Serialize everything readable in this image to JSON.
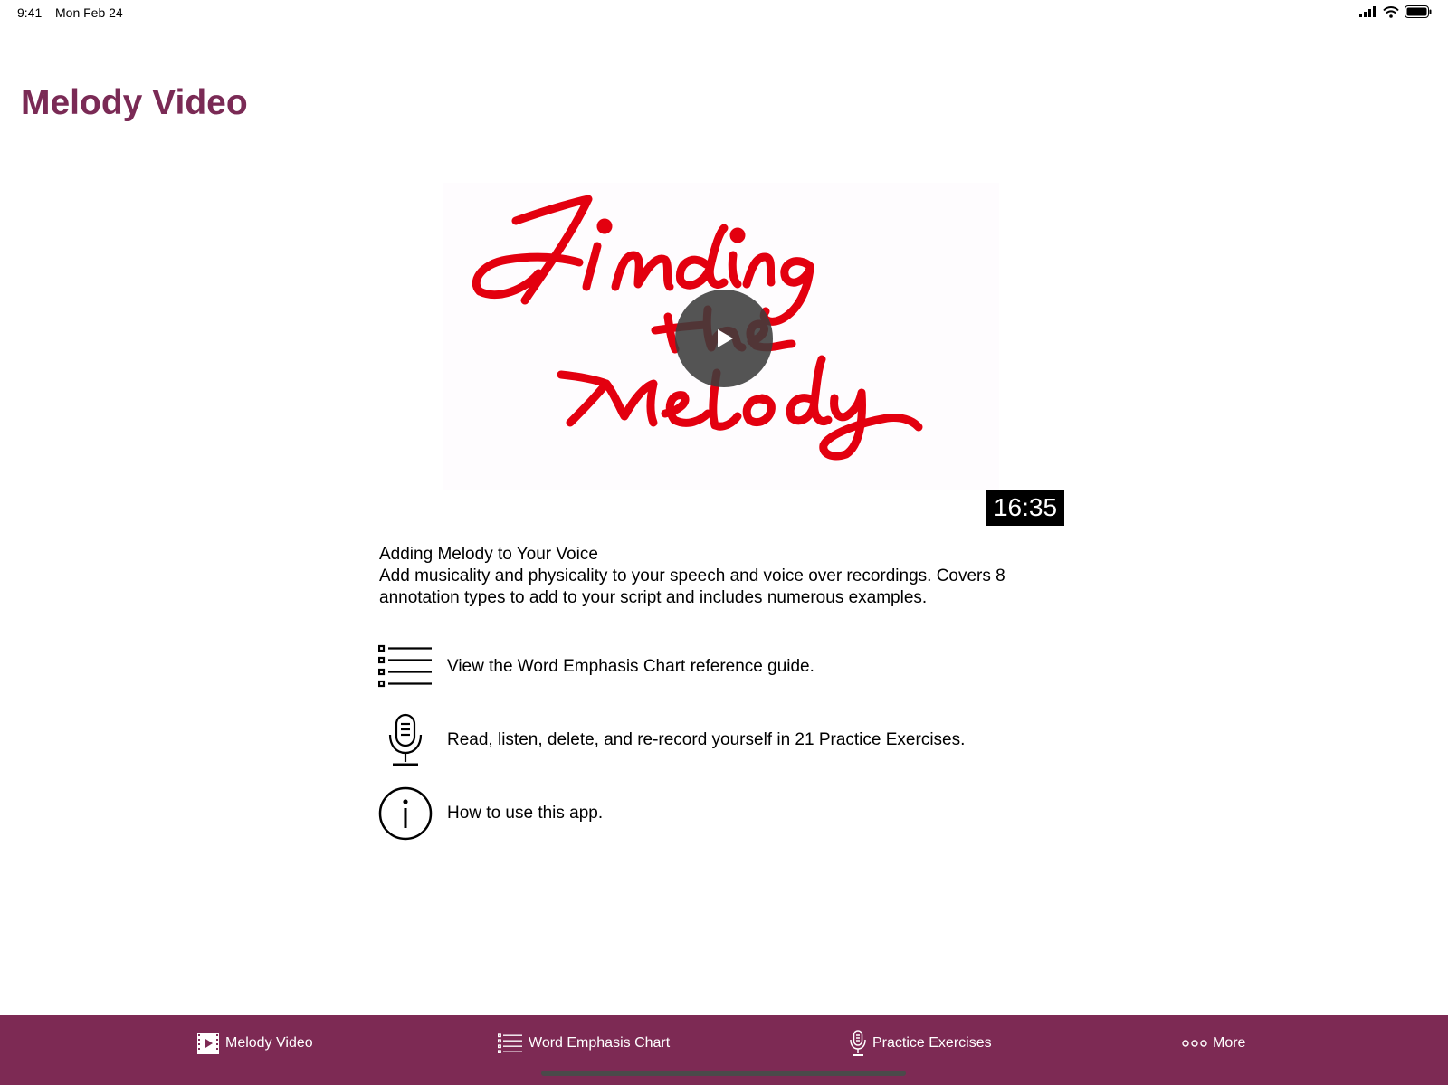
{
  "status_bar": {
    "time": "9:41",
    "date": "Mon Feb 24"
  },
  "page": {
    "title": "Melody Video"
  },
  "video": {
    "thumbnail_icon": "finding-the-melody-script-logo",
    "duration": "16:35",
    "title": "Adding Melody to Your Voice",
    "description": "Add musicality and physicality to your speech and voice over recordings.  Covers 8 annotation types to add to your script and includes numerous examples."
  },
  "links": [
    {
      "icon": "list-icon",
      "label": "View the Word Emphasis Chart reference guide."
    },
    {
      "icon": "microphone-icon",
      "label": "Read, listen, delete, and re-record yourself in 21 Practice Exercises."
    },
    {
      "icon": "info-icon",
      "label": "How to use this app."
    }
  ],
  "tab_bar": {
    "background": "#7d2a54",
    "tabs": [
      {
        "icon": "film-icon",
        "label": "Melody Video"
      },
      {
        "icon": "list-icon",
        "label": "Word Emphasis Chart"
      },
      {
        "icon": "microphone-icon",
        "label": "Practice Exercises"
      },
      {
        "icon": "more-dots-icon",
        "label": "More"
      }
    ]
  },
  "colors": {
    "title": "#7a2a55",
    "script_red": "#e3000f"
  }
}
